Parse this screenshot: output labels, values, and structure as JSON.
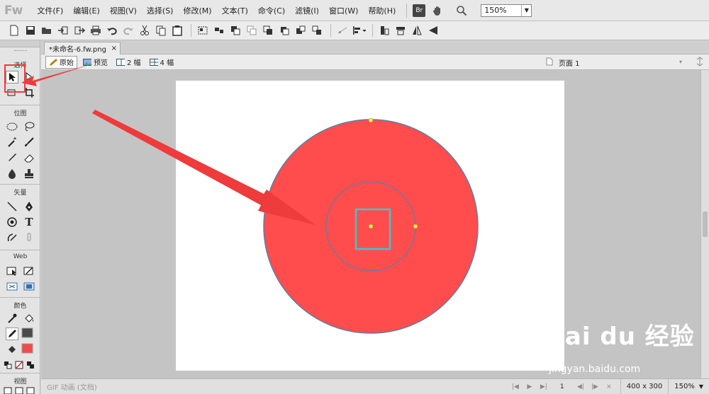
{
  "app": {
    "logo": "Fw",
    "menus": [
      "文件(F)",
      "编辑(E)",
      "视图(V)",
      "选择(S)",
      "修改(M)",
      "文本(T)",
      "命令(C)",
      "滤镜(I)",
      "窗口(W)",
      "帮助(H)"
    ],
    "bridge_label": "Br",
    "zoom": "150%"
  },
  "tools_panel": {
    "sections": {
      "select": "选择",
      "bitmap": "位图",
      "vector": "矢量",
      "web": "Web",
      "colors": "颜色",
      "view": "视图"
    },
    "fill_color": "#f04b4b",
    "stroke_color": "#4a4a4a"
  },
  "document": {
    "tab_title": "*未命名-6.fw.png",
    "close_glyph": "×",
    "views": [
      "原始",
      "预览",
      "2 幅",
      "4 幅"
    ],
    "active_view": "原始",
    "page_name": "页面 1"
  },
  "canvas": {
    "background": "#ffffff",
    "circle_fill": "#ff4d4d",
    "circle_stroke": "#5b7fa8",
    "selection_color": "#3cc7c7"
  },
  "status": {
    "format": "GIF 动画 (文档)",
    "frame": "1",
    "size": "400 x 300",
    "zoom": "150%"
  },
  "watermark": {
    "brand": "Bai du 经验",
    "url": "jingyan.baidu.com"
  },
  "annotation": {
    "color": "#ee3b3b"
  }
}
